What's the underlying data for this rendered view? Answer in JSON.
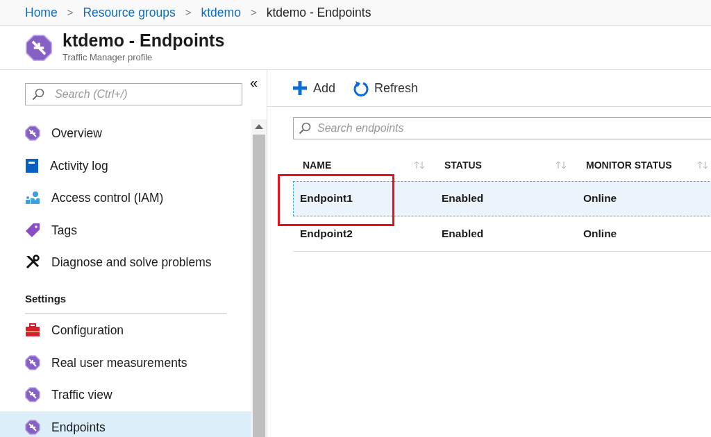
{
  "breadcrumb": [
    {
      "label": "Home",
      "current": false
    },
    {
      "label": "Resource groups",
      "current": false,
      "separator": ">"
    },
    {
      "label": "ktdemo",
      "current": false,
      "separator": ">"
    },
    {
      "label": "ktdemo - Endpoints",
      "current": true,
      "separator": ">"
    }
  ],
  "header": {
    "title": "ktdemo - Endpoints",
    "subtitle": "Traffic Manager profile"
  },
  "sidebar": {
    "collapse": "«",
    "search": {
      "placeholder": "Search (Ctrl+/)"
    },
    "sections": [
      {
        "items": [
          {
            "label": "Overview",
            "selected": false
          },
          {
            "label": "Activity log",
            "selected": false
          },
          {
            "label": "Access control (IAM)",
            "selected": false
          },
          {
            "label": "Tags",
            "selected": false
          },
          {
            "label": "Diagnose and solve problems",
            "selected": false
          }
        ]
      },
      {
        "heading": "Settings",
        "items": [
          {
            "label": "Configuration",
            "selected": false
          },
          {
            "label": "Real user measurements",
            "selected": false
          },
          {
            "label": "Traffic view",
            "selected": false
          },
          {
            "label": "Endpoints",
            "selected": true
          }
        ]
      }
    ]
  },
  "toolbar": [
    {
      "label": "Add"
    },
    {
      "label": "Refresh"
    }
  ],
  "search": {
    "placeholder": "Search endpoints"
  },
  "table": {
    "columns": [
      "NAME",
      "STATUS",
      "MONITOR STATUS"
    ],
    "rows": [
      {
        "cells": [
          "Endpoint1",
          "Enabled",
          "Online"
        ],
        "selected": true,
        "highlighted": true
      },
      {
        "cells": [
          "Endpoint2",
          "Enabled",
          "Online"
        ],
        "selected": false,
        "highlighted": false
      }
    ]
  }
}
